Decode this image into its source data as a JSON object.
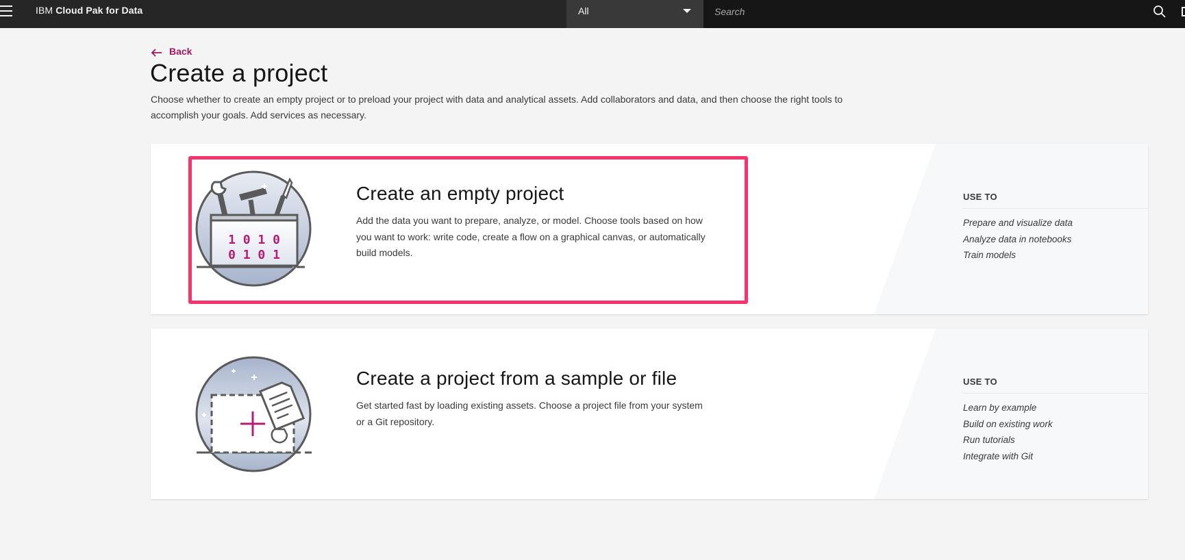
{
  "header": {
    "brand_prefix": "IBM",
    "brand_name": "Cloud Pak for Data",
    "scope_value": "All",
    "search_placeholder": "Search"
  },
  "page": {
    "back_label": "Back",
    "title": "Create a project",
    "description": "Choose whether to create an empty project or to preload your project with data and analytical assets. Add collaborators and data, and then choose the right tools to accomplish your goals. Add services as necessary."
  },
  "cards": [
    {
      "title": "Create an empty project",
      "description": "Add the data you want to prepare, analyze, or model. Choose tools based on how you want to work: write code, create a flow on a graphical canvas, or automatically build models.",
      "use_to_heading": "USE TO",
      "use_to": [
        "Prepare and visualize data",
        "Analyze data in notebooks",
        "Train models"
      ],
      "illustration_text": [
        "1 0 1 0",
        "0 1 0 1"
      ]
    },
    {
      "title": "Create a project from a sample or file",
      "description": "Get started fast by loading existing assets. Choose a project file from your system or a Git repository.",
      "use_to_heading": "USE TO",
      "use_to": [
        "Learn by example",
        "Build on existing work",
        "Run tutorials",
        "Integrate with Git"
      ]
    }
  ],
  "colors": {
    "accent": "#a2185f",
    "highlight": "#f5336d",
    "header_bg": "#262626"
  }
}
